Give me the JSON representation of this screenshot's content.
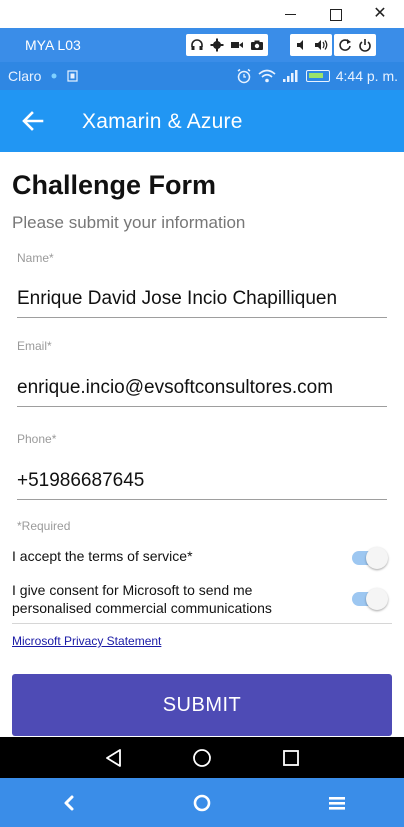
{
  "window": {
    "minimize_glyph": "",
    "maximize_glyph": "",
    "close_glyph": "✕"
  },
  "emulator": {
    "device_name": "MYA L03",
    "toolbar_icons": [
      "headphones-icon",
      "gear-icon",
      "video-icon",
      "camera-icon",
      "volume-down-icon",
      "volume-up-icon",
      "rotate-icon",
      "power-icon"
    ]
  },
  "status_bar": {
    "carrier": "Claro",
    "time": "4:44 p. m."
  },
  "app_bar": {
    "title": "Xamarin & Azure"
  },
  "form": {
    "title": "Challenge Form",
    "subtitle": "Please submit your information",
    "fields": [
      {
        "label": "Name*",
        "value": "Enrique David Jose Incio Chapilliquen"
      },
      {
        "label": "Email*",
        "value": "enrique.incio@evsoftconsultores.com"
      },
      {
        "label": "Phone*",
        "value": "+51986687645"
      }
    ],
    "required_note": "*Required",
    "terms_label": "I accept the terms of service*",
    "consent_label": "I give consent for Microsoft to send me personalised commercial communications",
    "terms_on": true,
    "consent_on": true,
    "privacy_link": "Microsoft Privacy Statement",
    "submit_label": "SUBMIT"
  },
  "colors": {
    "app_bar": "#2196f3",
    "status_bar": "#2f87e3",
    "submit": "#4e4bb5",
    "host_bar": "#3a8de8"
  }
}
